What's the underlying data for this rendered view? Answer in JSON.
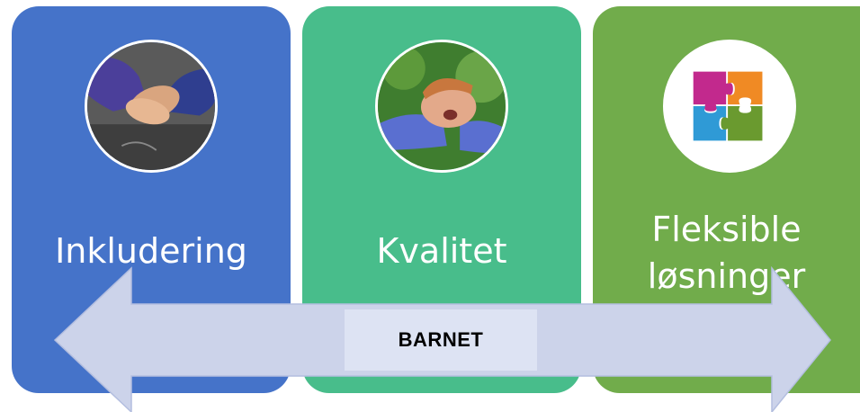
{
  "columns": [
    {
      "label": "Inkludering",
      "icon": "holding-hands-photo",
      "color": "#4573c9"
    },
    {
      "label": "Kvalitet",
      "icon": "child-smiling-photo",
      "color": "#48bd8b"
    },
    {
      "label": "Fleksible\nløsninger",
      "icon": "puzzle-pieces-icon",
      "color": "#71ac4b"
    }
  ],
  "center": {
    "label": "BARNET"
  },
  "arrow": {
    "color": "#ccd3ea",
    "stroke": "#b3bedf"
  }
}
